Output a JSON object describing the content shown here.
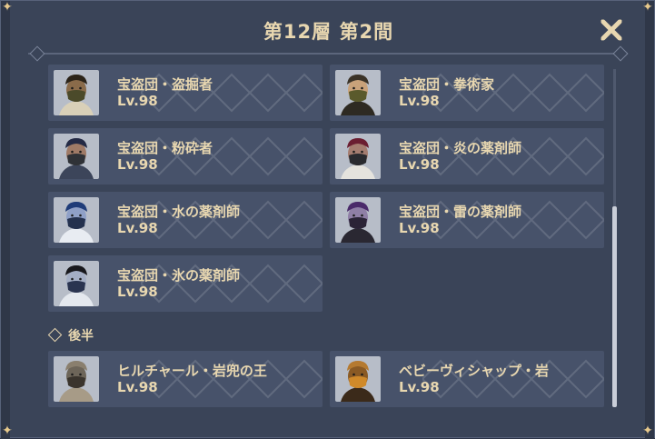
{
  "title": "第12層 第2間",
  "section_later": "後半",
  "top_enemies": [
    {
      "name": "宝盗団・盗掘者",
      "level": "Lv.98",
      "icon": "treasure-hoarder-digger-icon",
      "skin": "#8a6b4a",
      "mask": "#4b4a2a",
      "cloth": "#d9d0b8",
      "hat": "#2b2318"
    },
    {
      "name": "宝盗団・拳術家",
      "level": "Lv.98",
      "icon": "treasure-hoarder-fighter-icon",
      "skin": "#c9a27a",
      "mask": "#5a5a2c",
      "cloth": "#2e2a22",
      "hat": "#3b3328"
    },
    {
      "name": "宝盗団・粉砕者",
      "level": "Lv.98",
      "icon": "treasure-hoarder-crusher-icon",
      "skin": "#9f7a66",
      "mask": "#2f3237",
      "cloth": "#3c455a",
      "hat": "#242a45"
    },
    {
      "name": "宝盗団・炎の薬剤師",
      "level": "Lv.98",
      "icon": "treasure-hoarder-pyro-potioneer-icon",
      "skin": "#a57d70",
      "mask": "#2a2b2f",
      "cloth": "#e5e3dd",
      "hat": "#6b1e31"
    },
    {
      "name": "宝盗団・水の薬剤師",
      "level": "Lv.98",
      "icon": "treasure-hoarder-hydro-potioneer-icon",
      "skin": "#8fa0c7",
      "mask": "#24314e",
      "cloth": "#e8ecf2",
      "hat": "#1f3c79"
    },
    {
      "name": "宝盗団・雷の薬剤師",
      "level": "Lv.98",
      "icon": "treasure-hoarder-electro-potioneer-icon",
      "skin": "#8f7fa6",
      "mask": "#2a2336",
      "cloth": "#2a2832",
      "hat": "#4a2a6a"
    },
    {
      "name": "宝盗団・氷の薬剤師",
      "level": "Lv.98",
      "icon": "treasure-hoarder-cryo-potioneer-icon",
      "skin": "#a4aec4",
      "mask": "#2a3450",
      "cloth": "#e4e8ee",
      "hat": "#18181c"
    }
  ],
  "later_enemies": [
    {
      "name": "ヒルチャール・岩兜の王",
      "level": "Lv.98",
      "icon": "stonehide-lawachurl-icon",
      "skin": "#6d6559",
      "mask": "#3a342d",
      "cloth": "#a79b87",
      "hat": "#8a7f6e"
    },
    {
      "name": "ベビーヴィシャップ・岩",
      "level": "Lv.98",
      "icon": "geovishap-hatchling-icon",
      "skin": "#8a5a24",
      "mask": "#d08a2a",
      "cloth": "#3b2a1a",
      "hat": "#b57a30"
    }
  ],
  "close_icon": "close-icon"
}
